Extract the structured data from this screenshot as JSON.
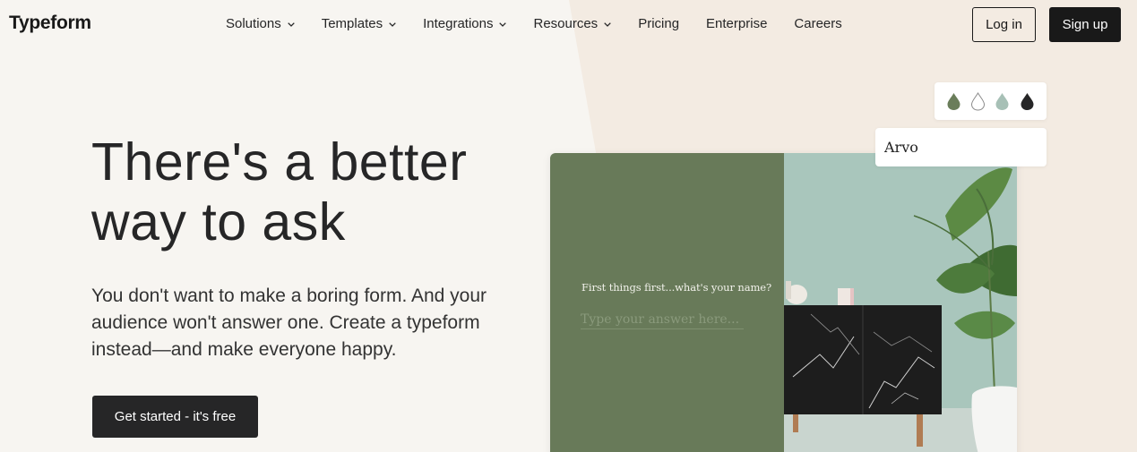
{
  "brand": {
    "logo_text": "Typeform"
  },
  "nav": {
    "items": [
      {
        "label": "Solutions",
        "dropdown": true
      },
      {
        "label": "Templates",
        "dropdown": true
      },
      {
        "label": "Integrations",
        "dropdown": true
      },
      {
        "label": "Resources",
        "dropdown": true
      },
      {
        "label": "Pricing",
        "dropdown": false
      },
      {
        "label": "Enterprise",
        "dropdown": false
      },
      {
        "label": "Careers",
        "dropdown": false
      }
    ],
    "login_label": "Log in",
    "signup_label": "Sign up"
  },
  "hero": {
    "title": "There's a better way to ask",
    "subtitle": "You don't want to make a boring form. And your audience won't answer one. Create a typeform instead—and make everyone happy.",
    "cta_label": "Get started - it's free"
  },
  "preview": {
    "question": "First things first...what's your name?",
    "input_placeholder": "Type your answer here..."
  },
  "theme_picker": {
    "color_swatches": [
      "#6a7d5a",
      "#ffffff",
      "#a7c0b6",
      "#262627"
    ],
    "font_name": "Arvo"
  },
  "colors": {
    "page_bg": "#f7f5f1",
    "accent_bg": "#f3ebe2",
    "dark": "#262627",
    "form_green": "#687a59"
  }
}
